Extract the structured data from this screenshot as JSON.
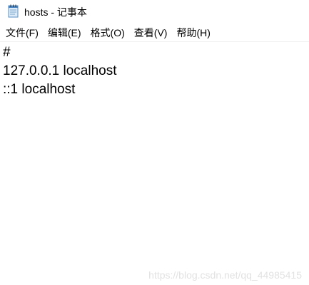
{
  "window": {
    "title": "hosts - 记事本",
    "icon": "notepad-icon"
  },
  "menubar": {
    "items": [
      {
        "label": "文件(F)"
      },
      {
        "label": "编辑(E)"
      },
      {
        "label": "格式(O)"
      },
      {
        "label": "查看(V)"
      },
      {
        "label": "帮助(H)"
      }
    ]
  },
  "editor": {
    "lines": [
      "#",
      "127.0.0.1 localhost",
      "::1 localhost"
    ]
  },
  "watermark": {
    "text": "https://blog.csdn.net/qq_44985415"
  }
}
